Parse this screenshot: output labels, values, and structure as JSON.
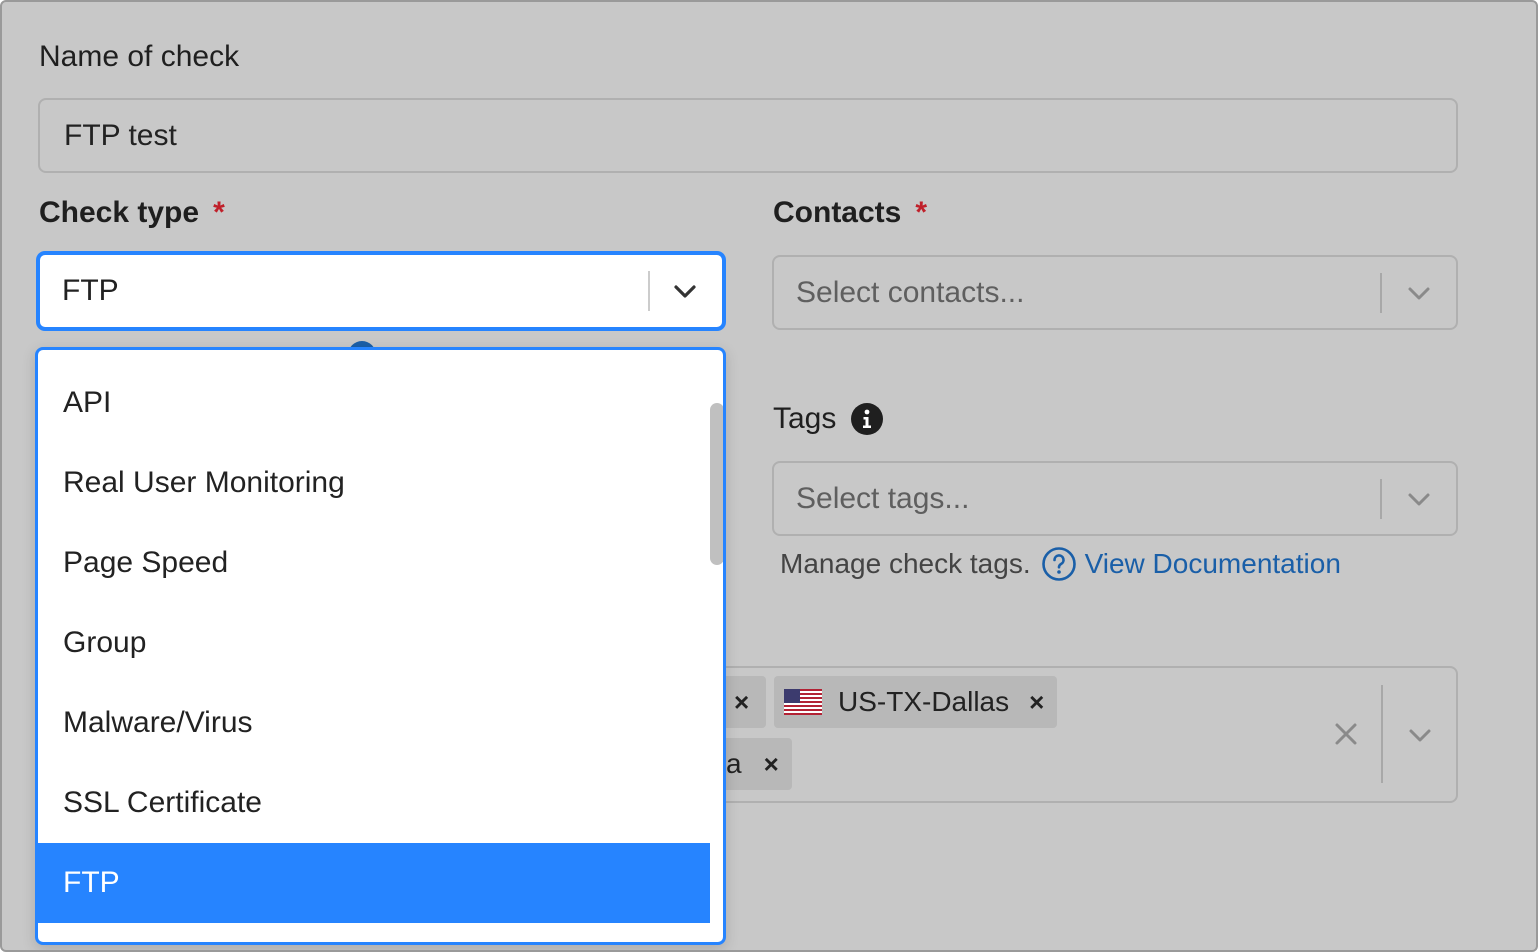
{
  "form": {
    "name_label": "Name of check",
    "name_value": "FTP test",
    "check_type_label": "Check type",
    "check_type_required": "*",
    "check_type_value": "FTP",
    "contacts_label": "Contacts",
    "contacts_required": "*",
    "contacts_placeholder": "Select contacts...",
    "tags_label": "Tags",
    "tags_placeholder": "Select tags...",
    "tags_help": "Manage check tags.",
    "tags_help_link": "View Documentation"
  },
  "dropdown": {
    "options": [
      {
        "label": "API",
        "selected": false
      },
      {
        "label": "Real User Monitoring",
        "selected": false
      },
      {
        "label": "Page Speed",
        "selected": false
      },
      {
        "label": "Group",
        "selected": false
      },
      {
        "label": "Malware/Virus",
        "selected": false
      },
      {
        "label": "SSL Certificate",
        "selected": false
      },
      {
        "label": "FTP",
        "selected": true
      }
    ]
  },
  "locations": {
    "chips": [
      {
        "label": "",
        "remove": "×"
      },
      {
        "label": "US-TX-Dallas",
        "remove": "×",
        "flag": "us-flag-icon"
      },
      {
        "label": "a",
        "remove": "×"
      }
    ]
  },
  "colors": {
    "accent": "#2684ff",
    "link": "#1a5fa8",
    "required": "#c0202a",
    "overlay_bg": "#c8c8c8"
  }
}
